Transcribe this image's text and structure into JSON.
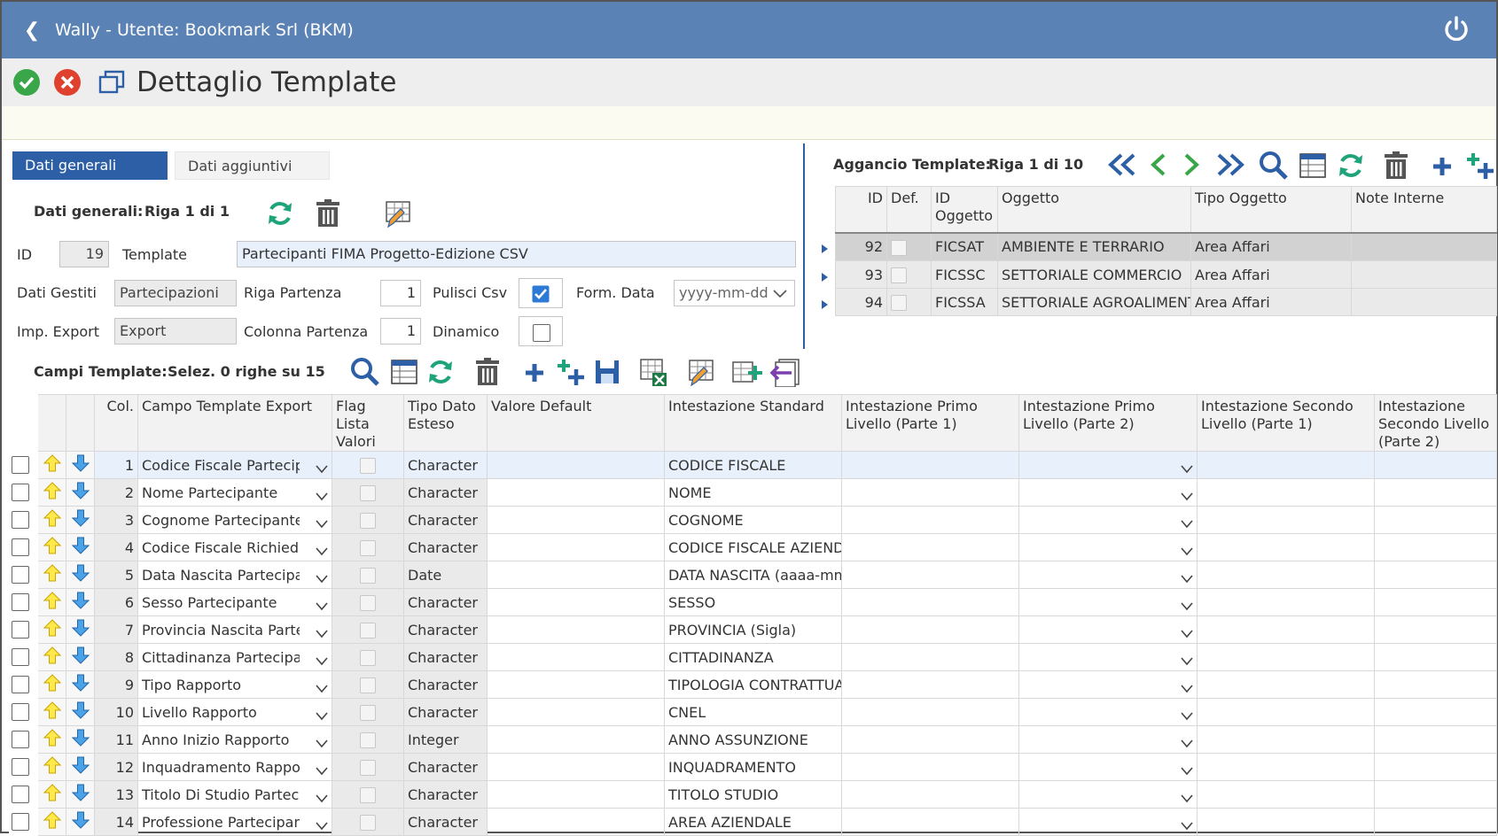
{
  "window": {
    "title": "Wally - Utente: Bookmark Srl (BKM)"
  },
  "page": {
    "title": "Dettaglio Template"
  },
  "tabs": [
    {
      "label": "Dati generali",
      "active": true
    },
    {
      "label": "Dati aggiuntivi",
      "active": false
    }
  ],
  "general": {
    "section_label": "Dati generali:",
    "riga": "Riga 1 di 1",
    "id_label": "ID",
    "id_value": "19",
    "template_label": "Template",
    "template_value": "Partecipanti FIMA Progetto-Edizione CSV",
    "dati_gestiti_label": "Dati Gestiti",
    "dati_gestiti_value": "Partecipazioni",
    "riga_partenza_label": "Riga Partenza",
    "riga_partenza_value": "1",
    "pulisci_label": "Pulisci Csv",
    "pulisci_checked": true,
    "form_data_label": "Form. Data",
    "form_data_value": "yyyy-mm-dd",
    "imp_export_label": "Imp. Export",
    "imp_export_value": "Export",
    "colonna_label": "Colonna Partenza",
    "colonna_value": "1",
    "dinamico_label": "Dinamico",
    "dinamico_checked": false
  },
  "aggancio": {
    "label": "Aggancio Template:",
    "riga": "Riga 1 di 10",
    "columns": [
      "ID",
      "Def.",
      "ID Oggetto",
      "Oggetto",
      "Tipo Oggetto",
      "Note Interne"
    ],
    "rows": [
      {
        "id": "92",
        "id_oggetto": "FICSAT",
        "oggetto": "AMBIENTE E TERRARIO",
        "tipo": "Area Affari",
        "note": ""
      },
      {
        "id": "93",
        "id_oggetto": "FICSSC",
        "oggetto": "SETTORIALE COMMERCIO",
        "tipo": "Area Affari",
        "note": ""
      },
      {
        "id": "94",
        "id_oggetto": "FICSSA",
        "oggetto": "SETTORIALE AGROALIMENT",
        "tipo": "Area Affari",
        "note": ""
      }
    ]
  },
  "campi": {
    "label": "Campi Template:",
    "selez": "Selez. 0 righe su 15",
    "columns": [
      "Col.",
      "Campo Template Export",
      "Flag Lista Valori",
      "Tipo Dato Esteso",
      "Valore Default",
      "Intestazione Standard",
      "Intestazione Primo Livello (Parte 1)",
      "Intestazione Primo Livello (Parte 2)",
      "Intestazione Secondo Livello (Parte 1)",
      "Intestazione Secondo Livello (Parte 2)"
    ],
    "rows": [
      {
        "col": "1",
        "campo": "Codice Fiscale Partecipante",
        "tipo": "Character",
        "std": "CODICE FISCALE"
      },
      {
        "col": "2",
        "campo": "Nome Partecipante",
        "tipo": "Character",
        "std": "NOME"
      },
      {
        "col": "3",
        "campo": "Cognome Partecipante",
        "tipo": "Character",
        "std": "COGNOME"
      },
      {
        "col": "4",
        "campo": "Codice Fiscale Richiedente",
        "tipo": "Character",
        "std": "CODICE FISCALE AZIENDA"
      },
      {
        "col": "5",
        "campo": "Data Nascita Partecipante",
        "tipo": "Date",
        "std": "DATA NASCITA (aaaa-mm-gg)"
      },
      {
        "col": "6",
        "campo": "Sesso Partecipante",
        "tipo": "Character",
        "std": "SESSO"
      },
      {
        "col": "7",
        "campo": "Provincia Nascita Partecipante",
        "tipo": "Character",
        "std": "PROVINCIA (Sigla)"
      },
      {
        "col": "8",
        "campo": "Cittadinanza Partecipante",
        "tipo": "Character",
        "std": "CITTADINANZA"
      },
      {
        "col": "9",
        "campo": "Tipo Rapporto",
        "tipo": "Character",
        "std": "TIPOLOGIA CONTRATTUALE"
      },
      {
        "col": "10",
        "campo": "Livello Rapporto",
        "tipo": "Character",
        "std": "CNEL"
      },
      {
        "col": "11",
        "campo": "Anno Inizio Rapporto",
        "tipo": "Integer",
        "std": "ANNO ASSUNZIONE"
      },
      {
        "col": "12",
        "campo": "Inquadramento Rapporto",
        "tipo": "Character",
        "std": "INQUADRAMENTO"
      },
      {
        "col": "13",
        "campo": "Titolo Di Studio Partecipante",
        "tipo": "Character",
        "std": "TITOLO STUDIO"
      },
      {
        "col": "14",
        "campo": "Professione Partecipante",
        "tipo": "Character",
        "std": "AREA AZIENDALE"
      }
    ]
  },
  "colors": {
    "titlebar": "#5b82b4",
    "accent": "#2d5fa6",
    "green": "#3aa64a",
    "red": "#e0402e",
    "teal": "#1fa37a"
  }
}
